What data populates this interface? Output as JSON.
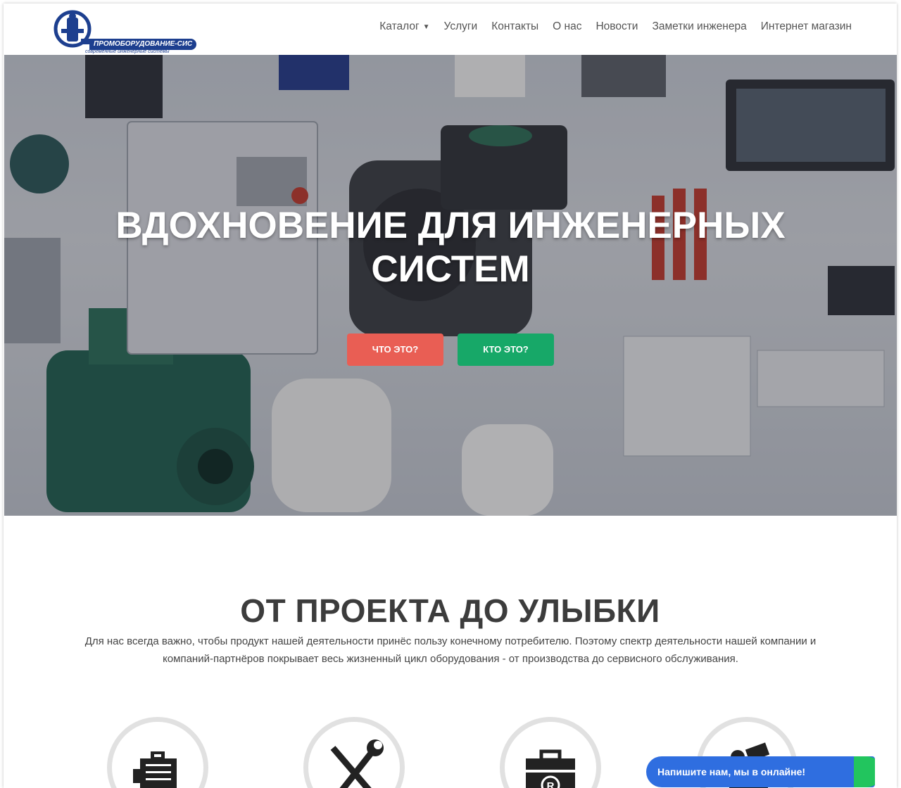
{
  "brand": {
    "name": "ПРОМОБОРУДОВАНИЕ-СИС",
    "tagline": "современные инженерные системы"
  },
  "nav": {
    "items": [
      {
        "label": "Каталог",
        "has_dropdown": true
      },
      {
        "label": "Услуги"
      },
      {
        "label": "Контакты"
      },
      {
        "label": "О нас"
      },
      {
        "label": "Новости"
      },
      {
        "label": "Заметки инженера"
      },
      {
        "label": "Интернет магазин"
      }
    ]
  },
  "hero": {
    "title_line1": "ВДОХНОВЕНИЕ ДЛЯ ИНЖЕНЕРНЫХ",
    "title_line2": "СИСТЕМ",
    "button_what": "ЧТО ЭТО?",
    "button_who": "КТО ЭТО?"
  },
  "section": {
    "title": "ОТ ПРОЕКТА ДО УЛЫБКИ",
    "description": "Для нас всегда важно, чтобы продукт нашей деятельности принёс пользу конечному потребителю. Поэтому спектр деятельности нашей компании и компаний-партнёров покрывает весь жизненный цикл оборудования - от производства до сервисного обслуживания."
  },
  "features": [
    {
      "icon": "electric-motor-icon"
    },
    {
      "icon": "wrench-screwdriver-icon"
    },
    {
      "icon": "registered-toolbox-icon"
    },
    {
      "icon": "equipment-icon"
    }
  ],
  "chat": {
    "label": "Напишите нам, мы в онлайне!"
  },
  "colors": {
    "brand_blue": "#1d3f8f",
    "button_red": "#e95e54",
    "button_green": "#17a868",
    "chat_blue": "#2f6ee0",
    "chat_green": "#22c55e"
  }
}
